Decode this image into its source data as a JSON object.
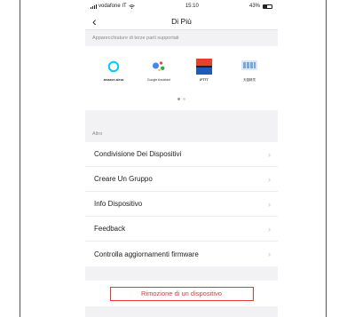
{
  "status_bar": {
    "carrier": "vodafone IT",
    "time": "15:10",
    "battery_percent": "43%",
    "battery_level": 0.43
  },
  "nav": {
    "back_icon": "chevron-left-icon",
    "title": "Di Più"
  },
  "partners_section": {
    "header": "Apparecchiature di terze parti supportati",
    "items": [
      {
        "label": "amazon alexa",
        "icon": "amazon-alexa-logo",
        "color": "#00caff"
      },
      {
        "label": "Google Assistant",
        "icon": "google-assistant-logo",
        "color": "#4285f4"
      },
      {
        "label": "IFTTT",
        "icon": "ifttt-logo",
        "color": "#e8402a"
      },
      {
        "label": "天猫精灵",
        "icon": "tmall-genie-logo",
        "color": "#7aa7d9"
      }
    ],
    "page_count": 2,
    "active_page": 1
  },
  "altro_section": {
    "header": "Altro",
    "items": [
      {
        "label": "Condivisione Dei Dispositivi"
      },
      {
        "label": "Creare Un Gruppo"
      },
      {
        "label": "Info Dispositivo"
      },
      {
        "label": "Feedback"
      },
      {
        "label": "Controlla aggiornamenti firmware"
      }
    ]
  },
  "remove_button": {
    "label": "Rimozione di un dispositivo",
    "color": "#e53935"
  }
}
